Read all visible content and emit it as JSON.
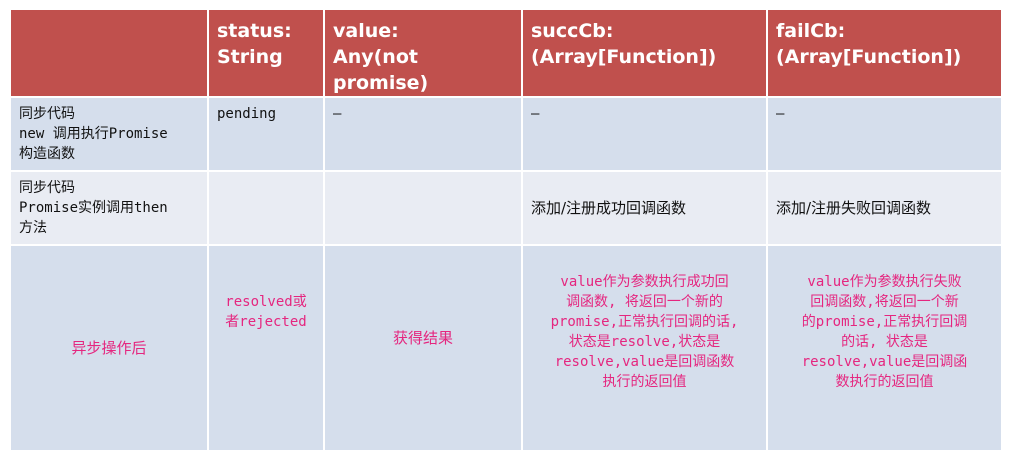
{
  "header": {
    "col0": "",
    "col1_line1": "status:",
    "col1_line2": "String",
    "col2_line1": "value:",
    "col2_line2": "Any(not promise)",
    "col3_line1": "succCb:",
    "col3_line2": "(Array[Function])",
    "col4_line1": "failCb:",
    "col4_line2": "(Array[Function])"
  },
  "rows": [
    {
      "label_lines": [
        "同步代码",
        "new 调用执行Promise",
        "构造函数"
      ],
      "status": "pending",
      "value": "–",
      "succCb": "–",
      "failCb": "–"
    },
    {
      "label_lines": [
        "同步代码",
        "Promise实例调用then",
        "方法"
      ],
      "status": "",
      "value": "",
      "succCb": "添加/注册成功回调函数",
      "failCb": "添加/注册失败回调函数"
    },
    {
      "label": "异步操作后",
      "status_lines": [
        "resolved或",
        "者rejected"
      ],
      "value": "获得结果",
      "succCb_lines": [
        "value作为参数执行成功回",
        "调函数, 将返回一个新的",
        "promise,正常执行回调的话,",
        "状态是resolve,状态是",
        "resolve,value是回调函数",
        "执行的返回值"
      ],
      "failCb_lines": [
        "value作为参数执行失败",
        "回调函数,将返回一个新",
        "的promise,正常执行回调",
        "的话, 状态是",
        "resolve,value是回调函",
        "数执行的返回值"
      ]
    }
  ],
  "colors": {
    "header_bg": "#c0504d",
    "row_bg": "#d5deec",
    "accent_text": "#e5267f"
  }
}
